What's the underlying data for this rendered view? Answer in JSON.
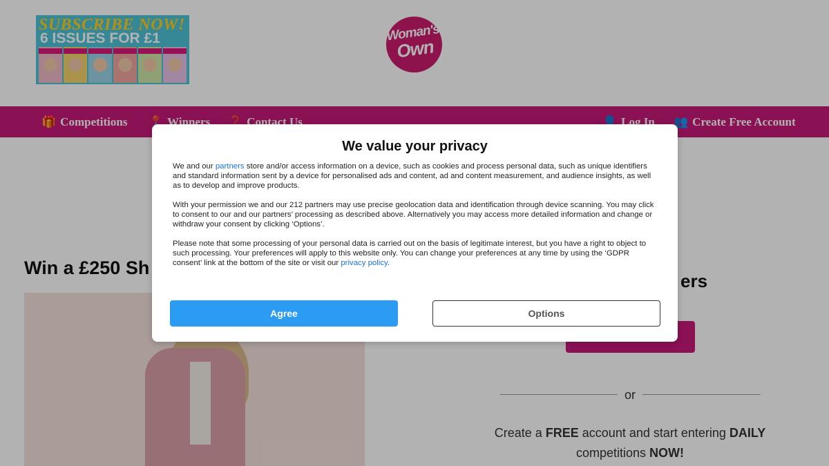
{
  "header": {
    "subscribe": {
      "line1": "SUBSCRIBE NOW!",
      "line2": "6 ISSUES FOR £1"
    },
    "logo": {
      "line1": "Woman's",
      "line2": "Own"
    }
  },
  "nav": {
    "left": [
      {
        "label": "Competitions",
        "icon": "gift-icon",
        "glyph": "🎁"
      },
      {
        "label": "Winners",
        "icon": "map-pin-icon",
        "glyph": "📍"
      },
      {
        "label": "Contact Us",
        "icon": "question-icon",
        "glyph": "❓"
      }
    ],
    "right": [
      {
        "label": "Log In",
        "icon": "user-icon",
        "glyph": "👤"
      },
      {
        "label": "Create Free Account",
        "icon": "user-plus-icon",
        "glyph": "👥"
      }
    ]
  },
  "main": {
    "win_title": "Win a £250 Sh",
    "right_title": "ers",
    "or": "or",
    "create": {
      "p1": "Create a ",
      "b1": "FREE",
      "p2": " account and start entering ",
      "b2": "DAILY",
      "p3": " competitions ",
      "b3": "NOW!"
    }
  },
  "privacy_modal": {
    "title": "We value your privacy",
    "para1": {
      "before": "We and our ",
      "link": "partners",
      "after": " store and/or access information on a device, such as cookies and process personal data, such as unique identifiers and standard information sent by a device for personalised ads and content, ad and content measurement, and audience insights, as well as to develop and improve products."
    },
    "para2": "With your permission we and our 212 partners may use precise geolocation data and identification through device scanning. You may click to consent to our and our partners’ processing as described above. Alternatively you may access more detailed information and change or withdraw your consent by clicking ‘Options’.",
    "para3": {
      "before": "Please note that some processing of your personal data is carried out on the basis of legitimate interest, but you have a right to object to such processing. Your preferences will apply to this website only. You can change your preferences at any time by using the ‘GDPR consent’ link at the bottom of the site or visit our ",
      "link": "privacy policy",
      "after": "."
    },
    "agree_label": "Agree",
    "options_label": "Options"
  },
  "colors": {
    "brand_pink": "#c7197a",
    "agree_blue": "#2b9bf4",
    "link_blue": "#1a73e8"
  }
}
